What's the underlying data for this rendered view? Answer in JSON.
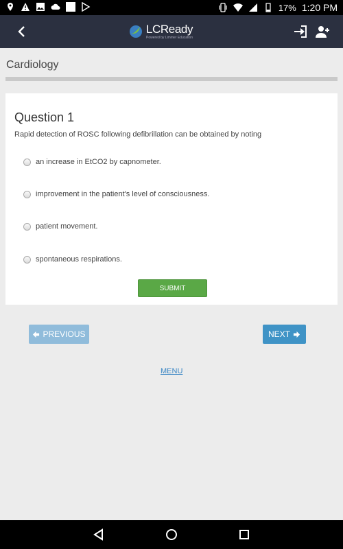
{
  "status": {
    "battery": "17%",
    "time": "1:20 PM"
  },
  "app": {
    "name": "LCReady",
    "tagline": "Powered by Limmer Education"
  },
  "page": {
    "title": "Cardiology"
  },
  "question": {
    "title": "Question 1",
    "text": "Rapid detection of ROSC following defibrillation can be obtained by noting",
    "options": [
      "an increase in EtCO2 by capnometer.",
      "improvement in the patient's level of consciousness.",
      "patient movement.",
      "spontaneous respirations."
    ],
    "submit_label": "SUBMIT"
  },
  "nav": {
    "previous_label": "PREVIOUS",
    "next_label": "NEXT",
    "menu_label": "MENU"
  },
  "colors": {
    "appbar": "#2b3040",
    "submit": "#5aa846",
    "next": "#3f93c6",
    "previous": "#90bcdb"
  }
}
